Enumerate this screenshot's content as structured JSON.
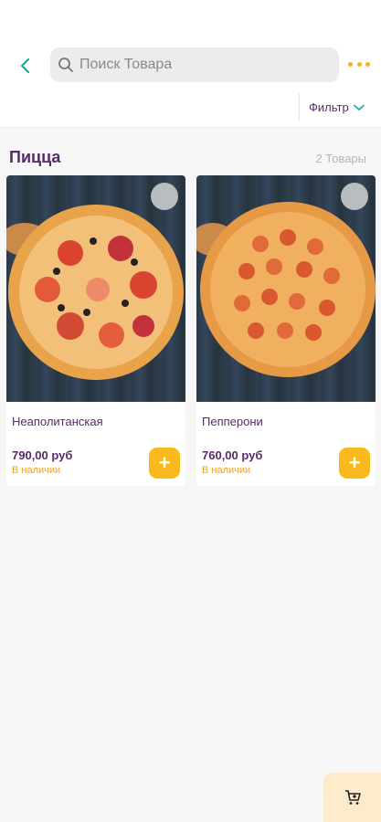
{
  "header": {
    "back_icon": "chevron-left-icon",
    "search_placeholder": "Поиск Товара",
    "more_icon": "more-dots-icon",
    "accent": "#f5b21a"
  },
  "filter": {
    "label": "Фильтр",
    "icon": "chevron-down-icon"
  },
  "section": {
    "title": "Пицца",
    "count": "2 Товары"
  },
  "products": [
    {
      "name": "Неаполитанская",
      "price": "790,00  руб",
      "stock": "В наличии",
      "add_label": "+"
    },
    {
      "name": "Пепперони",
      "price": "760,00  руб",
      "stock": "В наличии",
      "add_label": "+"
    }
  ],
  "cart": {
    "icon": "cart-icon"
  },
  "colors": {
    "title": "#5a2a6a",
    "stock": "#f0a21a",
    "add_button": "#f9b81c",
    "cart_fab": "#fdeccb"
  }
}
